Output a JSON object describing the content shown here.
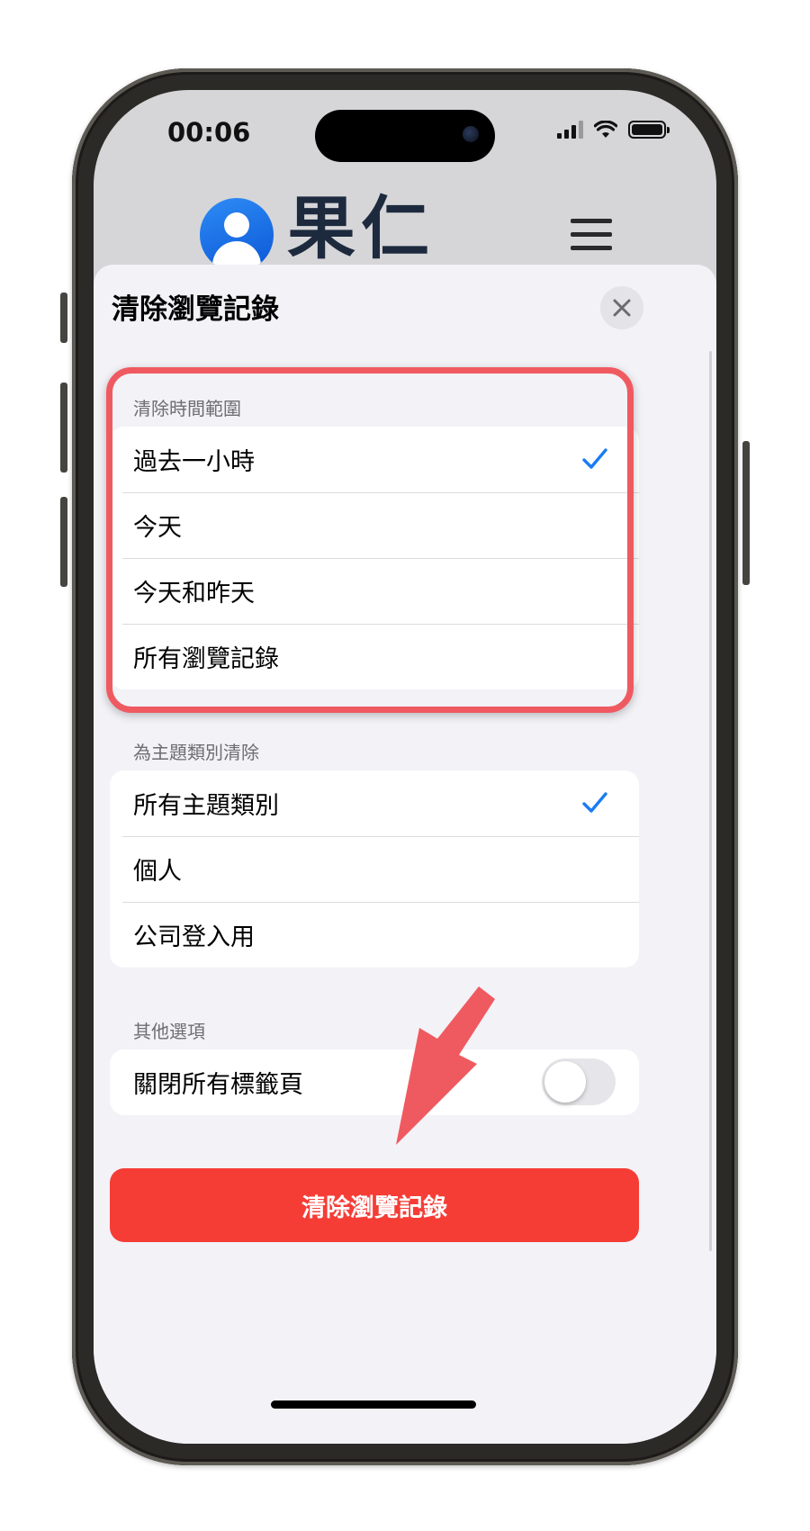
{
  "status_bar": {
    "time": "00:06"
  },
  "site": {
    "name": "果仁"
  },
  "sheet": {
    "title": "清除瀏覽記錄",
    "time_range": {
      "label": "清除時間範圍",
      "options": [
        "過去一小時",
        "今天",
        "今天和昨天",
        "所有瀏覽記錄"
      ],
      "selected_index": 0
    },
    "profiles": {
      "label": "為主題類別清除",
      "options": [
        "所有主題類別",
        "個人",
        "公司登入用"
      ],
      "selected_index": 0
    },
    "other": {
      "label": "其他選項",
      "close_tabs_label": "關閉所有標籤頁",
      "close_tabs_on": false
    },
    "clear_button": "清除瀏覽記錄"
  },
  "colors": {
    "accent": "#1a7cf5",
    "destructive": "#f53d36",
    "highlight_box": "#ef5a60",
    "arrow": "#ef5a60"
  }
}
